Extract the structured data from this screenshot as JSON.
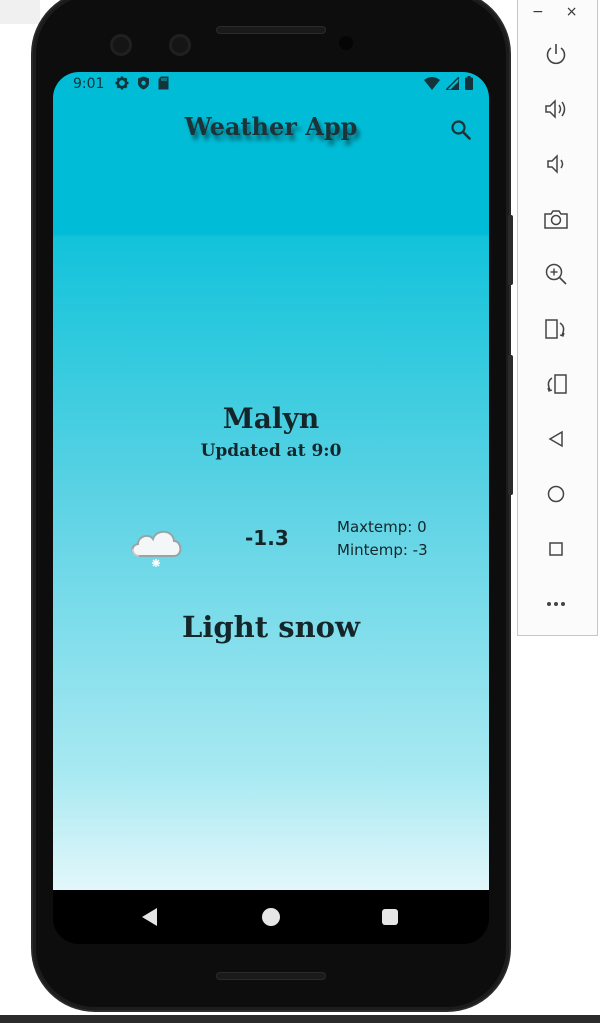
{
  "status_bar": {
    "time": "9:01",
    "left_icons": [
      "settings-icon",
      "shield-icon",
      "sd-card-icon"
    ],
    "right_icons": [
      "wifi-icon",
      "signal-icon",
      "battery-icon"
    ]
  },
  "app_bar": {
    "title": "Weather App",
    "action_icon": "search-icon"
  },
  "weather": {
    "city": "Malyn",
    "updated": "Updated at 9:0",
    "icon": "cloud-snow-icon",
    "temperature": "-1.3",
    "max_temp": "Maxtemp: 0",
    "min_temp": "Mintemp: -3",
    "description": "Light snow"
  },
  "colors": {
    "app_top": "#00bcd6",
    "app_bottom": "#e2f7fa",
    "text_dark": "#15262a"
  },
  "nav_bar": [
    "back-icon",
    "home-icon",
    "recents-icon"
  ],
  "emulator_toolbar": {
    "minimize": "−",
    "close": "×",
    "buttons": [
      "power-icon",
      "volume-up-icon",
      "volume-down-icon",
      "camera-icon",
      "zoom-icon",
      "rotate-left-icon",
      "rotate-right-icon",
      "back-icon",
      "home-icon",
      "overview-icon",
      "more-icon"
    ]
  }
}
